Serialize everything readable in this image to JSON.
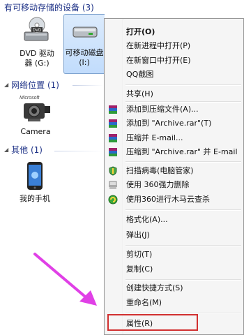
{
  "groups": {
    "removable": "有可移动存储的设备 (3)",
    "network": "网络位置 (1)",
    "other": "其他 (1)"
  },
  "devices": {
    "dvd_line1": "DVD 驱动",
    "dvd_line2": "器 (G:)",
    "removable_line1": "可移动磁盘",
    "removable_line2": "(I:)",
    "camera": "Camera",
    "phone": "我的手机",
    "camera_brand": "Microsoft"
  },
  "menu": {
    "open": "打开(O)",
    "open_new_process": "在新进程中打开(P)",
    "open_new_window": "在新窗口中打开(E)",
    "qq_screenshot": "QQ截图",
    "share": "共享(H)",
    "add_to_archive": "添加到压缩文件(A)...",
    "add_to_rar": "添加到 \"Archive.rar\"(T)",
    "compress_email": "压缩并 E-mail...",
    "compress_rar_email": "压缩到 \"Archive.rar\" 并 E-mail",
    "scan_virus": "扫描病毒(电脑管家)",
    "force_delete": "使用 360强力删除",
    "trojan_scan": "使用360进行木马云查杀",
    "format": "格式化(A)...",
    "eject": "弹出(J)",
    "cut": "剪切(T)",
    "copy": "复制(C)",
    "create_shortcut": "创建快捷方式(S)",
    "rename": "重命名(M)",
    "properties": "属性(R)"
  },
  "colors": {
    "arrow": "#e040e6",
    "highlight": "#d13030",
    "header": "#1e3287"
  }
}
